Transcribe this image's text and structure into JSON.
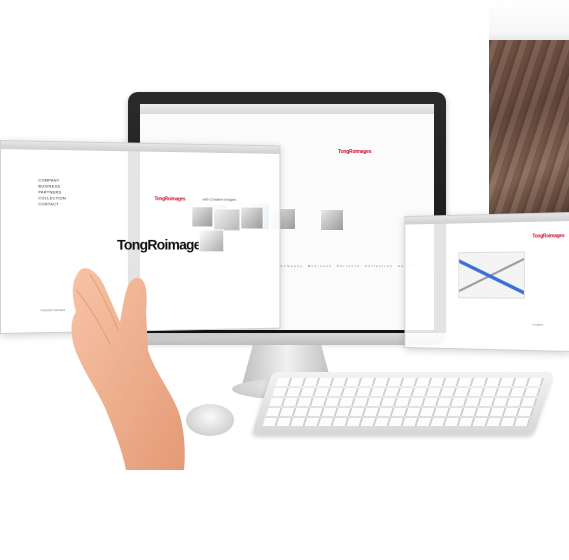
{
  "brand": {
    "logo_text_large": "TongRoimages",
    "logo_text_small": "TongRoimages",
    "tagline": "with Creative Images"
  },
  "left_panel": {
    "nav_items": [
      "COMPANY",
      "BUSINESS",
      "PARTNERS",
      "COLLECTION",
      "CONTACT"
    ],
    "footer_text": "TONGRO IMAGES"
  },
  "imac_screen": {
    "menu_items": [
      "Company",
      "Business",
      "Partners",
      "Collection",
      "Contact"
    ]
  },
  "right_panel": {
    "map_label": "Location"
  }
}
